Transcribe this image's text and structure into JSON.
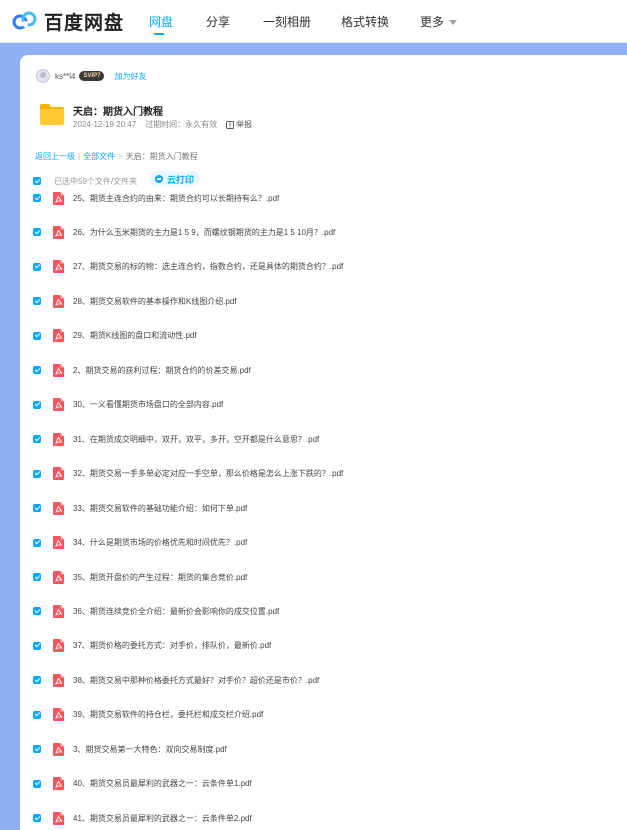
{
  "app": {
    "logo_text": "百度网盘",
    "nav": [
      {
        "label": "网盘",
        "active": true
      },
      {
        "label": "分享",
        "active": false
      },
      {
        "label": "一刻相册",
        "active": false
      },
      {
        "label": "格式转换",
        "active": false
      },
      {
        "label": "更多",
        "active": false
      }
    ],
    "accent_color": "#06a7ff",
    "background_color": "#8fb0f5"
  },
  "sharer": {
    "username": "ks**l4",
    "badge": "SVIP7",
    "add_friend_label": "加为好友"
  },
  "share": {
    "title": "天启：期货入门教程",
    "date": "2024-12-19 20:47",
    "expiry": "过期时间：永久有效",
    "report_label": "举报"
  },
  "breadcrumb": {
    "back": "返回上一级",
    "all_files": "全部文件",
    "current": "天启：期货入门教程"
  },
  "selection": {
    "status": "已选中59个文件/文件夹",
    "cloud_print_label": "云打印"
  },
  "files": [
    "25、期货主连合约的由来：期货合约可以长期持有么？.pdf",
    "26、为什么玉米期货的主力是1 5 9，而螺纹钢期货的主力是1 5 10月？.pdf",
    "27、期货交易的标的物：选主连合约，指数合约，还是具体的期货合约？.pdf",
    "28、期货交易软件的基本操作和K线图介绍.pdf",
    "29、期货K线图的盘口和流动性.pdf",
    "2、期货交易的获利过程：期货合约的价差交易.pdf",
    "30、一义看懂期货市场盘口的全部内容.pdf",
    "31、在期货成交明细中，双开，双平，多开，空开都是什么意思？.pdf",
    "32、期货交易一手多单必定对应一手空单，那么价格是怎么上涨下跌的？.pdf",
    "33、期货交易软件的基础功能介绍：如何下单.pdf",
    "34、什么是期货市场的价格优先和时间优先？.pdf",
    "35、期货开盘价的产生过程：期货的集合竞价.pdf",
    "36、期货连续竞价全介绍：最新价会影响你的成交位置.pdf",
    "37、期货价格的委托方式：对手价，排队价，最新价.pdf",
    "38、期货交易中那种价格委托方式最好？对手价？超价还是市价？.pdf",
    "39、期货交易软件的持仓栏，委托栏和成交栏介绍.pdf",
    "3、期货交易第一大特色：双向交易制度.pdf",
    "40、期货交易员最犀利的武器之一：云条件单1.pdf",
    "41、期货交易员最犀利的武器之一：云条件单2.pdf"
  ]
}
